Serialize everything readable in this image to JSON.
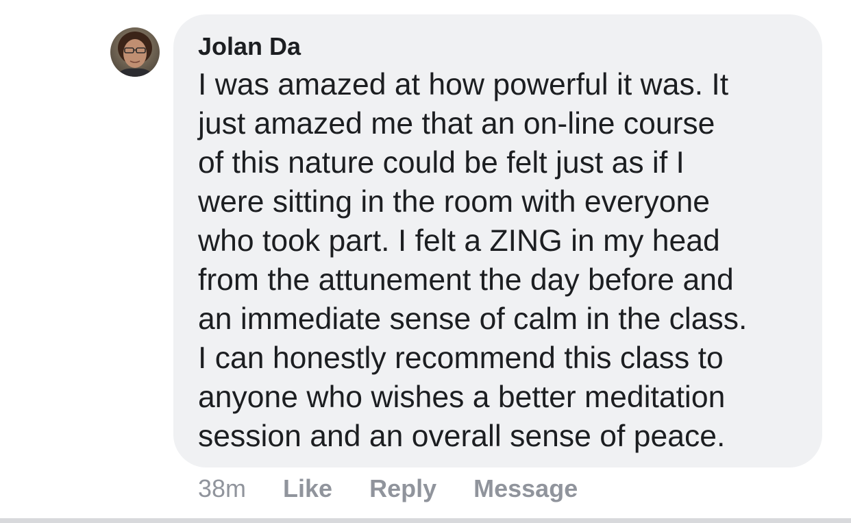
{
  "comment": {
    "author": "Jolan Da",
    "lines": [
      "I was amazed at how powerful it was.  It",
      "just amazed me that an on-line course",
      "of this nature could be felt just as if I",
      "were sitting in the room with everyone",
      "who took part.  I felt a ZING in my head",
      "from the attunement the day before and",
      "an immediate sense of calm in the class.",
      "I can honestly recommend this class to",
      "anyone who wishes a better meditation",
      "session and an overall sense of peace."
    ],
    "avatar_icon": "profile-photo-icon"
  },
  "actions": {
    "timestamp": "38m",
    "like_label": "Like",
    "reply_label": "Reply",
    "message_label": "Message"
  },
  "colors": {
    "bubble_bg": "#f0f1f3",
    "text": "#1c1e21",
    "meta": "#90949c"
  }
}
